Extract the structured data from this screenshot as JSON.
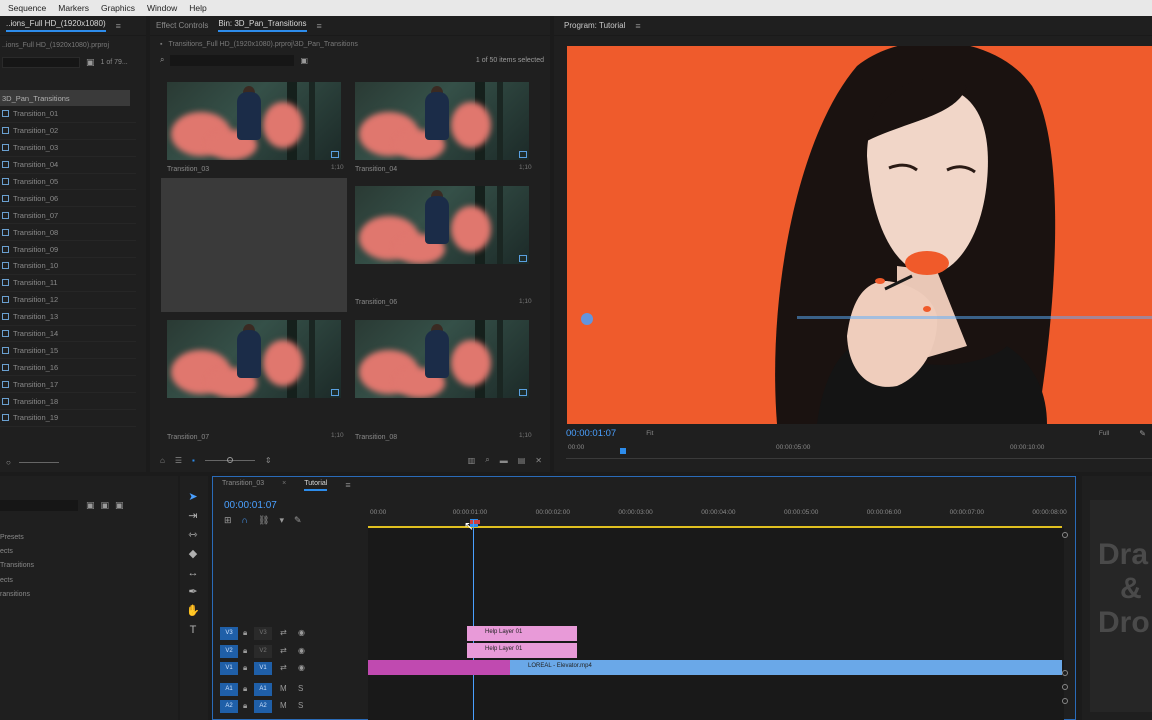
{
  "menu": [
    "Sequence",
    "Markers",
    "Graphics",
    "Window",
    "Help"
  ],
  "project": {
    "title": "..ions_Full HD_(1920x1080)",
    "path": "..ions_Full HD_(1920x1080).prproj",
    "count": "1 of 79...",
    "folder": "3D_Pan_Transitions",
    "items": [
      "Transition_01",
      "Transition_02",
      "Transition_03",
      "Transition_04",
      "Transition_05",
      "Transition_06",
      "Transition_07",
      "Transition_08",
      "Transition_09",
      "Transition_10",
      "Transition_11",
      "Transition_12",
      "Transition_13",
      "Transition_14",
      "Transition_15",
      "Transition_16",
      "Transition_17",
      "Transition_18",
      "Transition_19"
    ]
  },
  "bin": {
    "tab_effects": "Effect Controls",
    "tab_bin": "Bin: 3D_Pan_Transitions",
    "path": "Transitions_Full HD_(1920x1080).prproj\\3D_Pan_Transitions",
    "selected": "1 of 50 items selected",
    "thumbs": [
      {
        "label": "Transition_03",
        "count": "1;10"
      },
      {
        "label": "Transition_04",
        "count": "1;10"
      },
      {
        "label": "Transition_05",
        "count": "1;10"
      },
      {
        "label": "Transition_06",
        "count": "1;10"
      },
      {
        "label": "Transition_07",
        "count": "1;10"
      },
      {
        "label": "Transition_08",
        "count": "1;10"
      }
    ]
  },
  "program": {
    "title": "Program: Tutorial",
    "timecode": "00:00:01:07",
    "fit": "Fit",
    "full": "Full",
    "ruler": [
      "00:00",
      "00:00:05:00",
      "00:00:10:00"
    ]
  },
  "effects": {
    "items": [
      "Presets",
      "ects",
      "Transitions",
      "ects",
      "ransitions"
    ]
  },
  "timeline": {
    "tab_transition": "Transition_03",
    "tab_tutorial": "Tutorial",
    "timecode": "00:00:01:07",
    "ruler": [
      "00:00",
      "00:00:01:00",
      "00:00:02:00",
      "00:00:03:00",
      "00:00:04:00",
      "00:00:05:00",
      "00:00:06:00",
      "00:00:07:00",
      "00:00:08:00"
    ],
    "tracks": [
      {
        "left": "V3",
        "right": "V3"
      },
      {
        "left": "V2",
        "right": "V2"
      },
      {
        "left": "V1",
        "right": "V1"
      },
      {
        "left": "A1",
        "right": "A1"
      },
      {
        "left": "A2",
        "right": "A2"
      }
    ],
    "clips": {
      "help1": "Help Layer 01",
      "help2": "Help Layer 01",
      "main": "LOREAL - Elevator.mp4"
    }
  },
  "essential": {
    "lines": [
      "Dra",
      "&",
      "Dro"
    ]
  },
  "colors": {
    "accent": "#2d8ceb",
    "video_bg": "#ef5b2c",
    "clip_pink": "#e89ad8",
    "clip_blue": "#6aa8e8",
    "clip_magenta": "#c04ab0",
    "playhead_bar": "#e0c020"
  }
}
